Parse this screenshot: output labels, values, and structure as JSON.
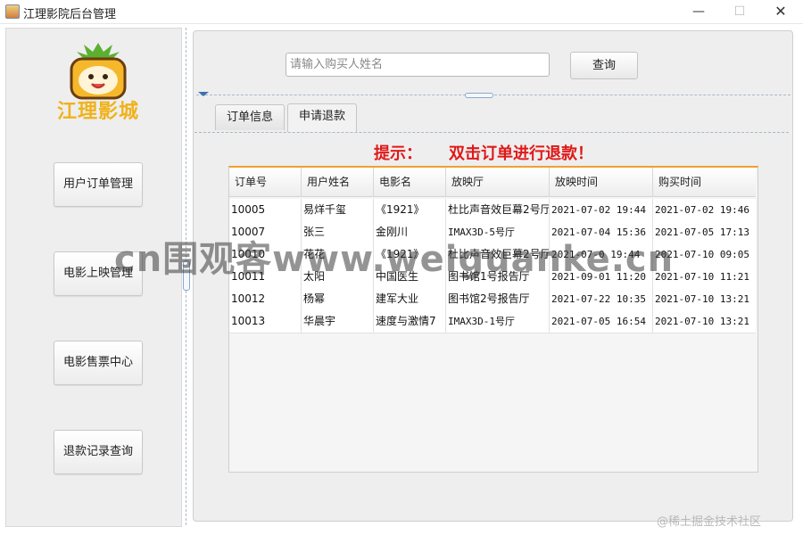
{
  "window": {
    "title": "江理影院后台管理",
    "min": "—",
    "max": "☐",
    "close": "✕"
  },
  "sidebar": {
    "logo_text": "江理影城",
    "items": [
      {
        "label": "用户订单管理"
      },
      {
        "label": "电影上映管理"
      },
      {
        "label": "电影售票中心"
      },
      {
        "label": "退款记录查询"
      }
    ]
  },
  "search": {
    "placeholder": "请输入购买人姓名",
    "button": "查询"
  },
  "tabs": [
    {
      "label": "订单信息"
    },
    {
      "label": "申请退款",
      "active": true
    }
  ],
  "hint": {
    "prefix": "提示：",
    "text": "双击订单进行退款！"
  },
  "table": {
    "headers": [
      "订单号",
      "用户姓名",
      "电影名",
      "放映厅",
      "放映时间",
      "购买时间"
    ],
    "rows": [
      [
        "10005",
        "易烊千玺",
        "《1921》",
        "杜比声音效巨幕2号厅",
        "2021-07-02 19:44",
        "2021-07-02 19:46"
      ],
      [
        "10007",
        "张三",
        "金刚川",
        "IMAX3D-5号厅",
        "2021-07-04 15:36",
        "2021-07-05 17:13"
      ],
      [
        "10010",
        "花花",
        "《1921》",
        "杜比声音效巨幕2号厅",
        "2021-07-0 19:44",
        "2021-07-10 09:05"
      ],
      [
        "10011",
        "太阳",
        "中国医生",
        "图书馆1号报告厅",
        "2021-09-01 11:20",
        "2021-07-10 11:21"
      ],
      [
        "10012",
        "杨幂",
        "建军大业",
        "图书馆2号报告厅",
        "2021-07-22 10:35",
        "2021-07-10 13:21"
      ],
      [
        "10013",
        "华晨宇",
        "速度与激情7",
        "IMAX3D-1号厅",
        "2021-07-05 16:54",
        "2021-07-10 13:21"
      ]
    ]
  },
  "watermark": "cn围观客www.weiguanke.cn",
  "credit": "@稀土掘金技术社区",
  "colors": {
    "hint": "#e01818",
    "logo": "#f0b21a",
    "table_accent": "#f0a030"
  }
}
